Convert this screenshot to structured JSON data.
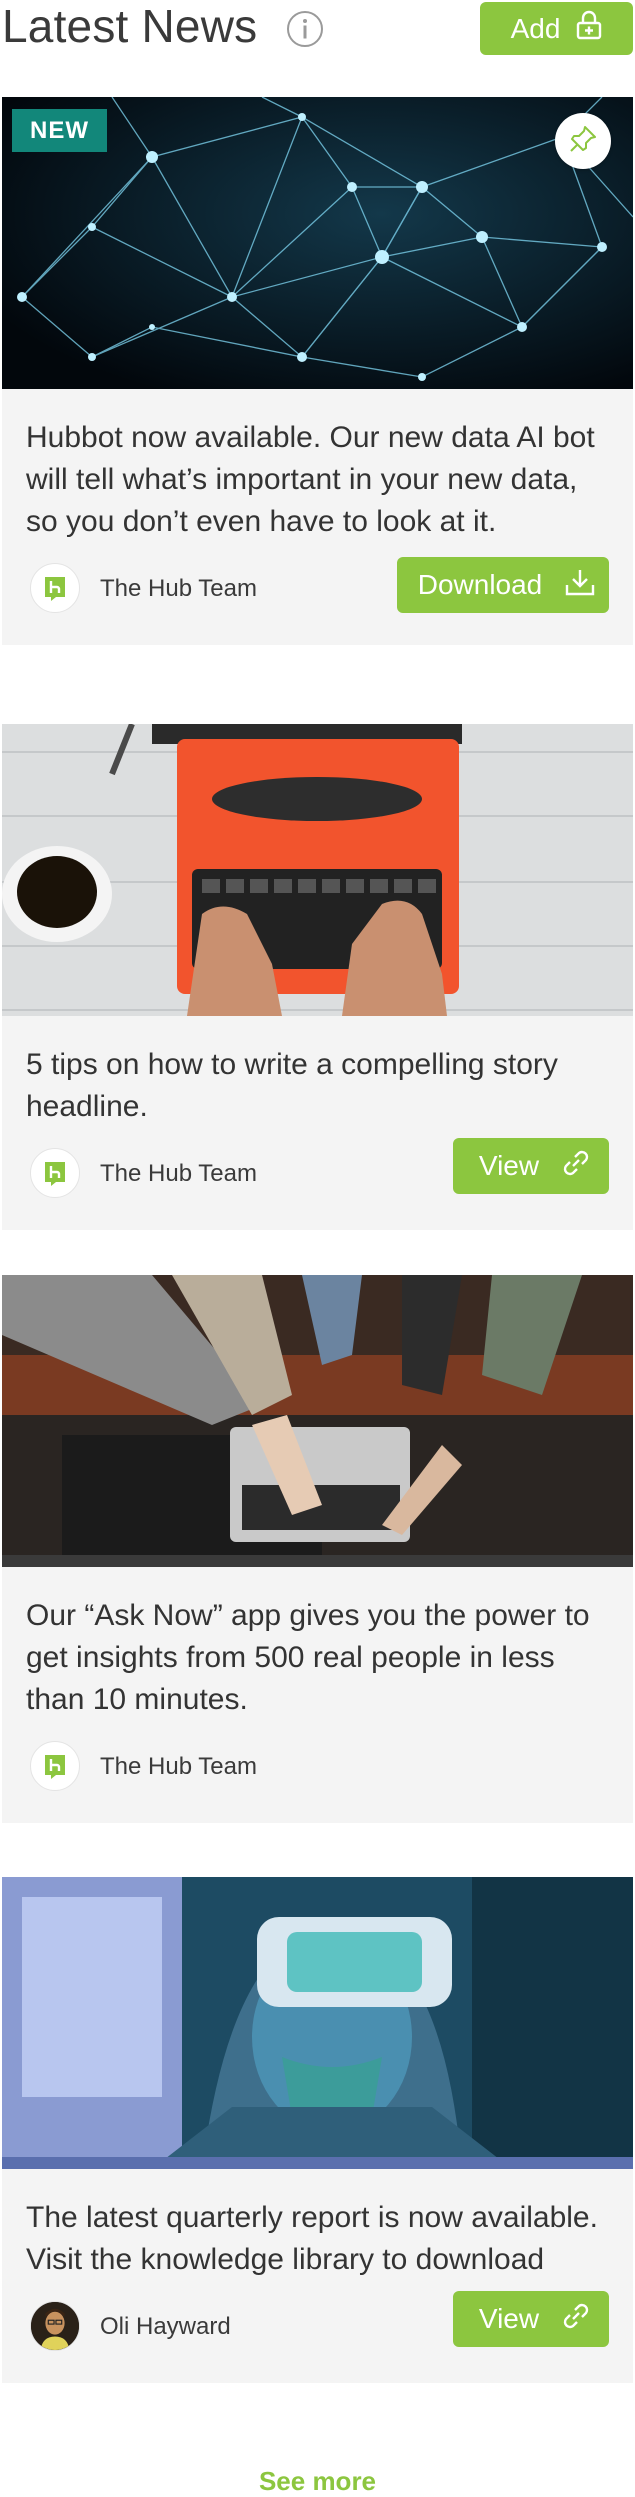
{
  "header": {
    "title": "Latest News",
    "info_icon": "info-icon",
    "add_label": "Add",
    "add_icon": "lock-plus-icon"
  },
  "colors": {
    "accent": "#8cc63f",
    "badge": "#12877a",
    "card_bg": "#f4f4f4"
  },
  "cards": [
    {
      "badge": "NEW",
      "pinned_icon": "pin-icon",
      "image": "network-nodes-image",
      "headline": "Hubbot now available. Our new data AI bot will tell what’s important in your new data, so you don’t even have to look at it.",
      "author": "The Hub Team",
      "author_avatar": "hub-logo-icon",
      "action_label": "Download",
      "action_icon": "download-icon"
    },
    {
      "image": "typewriter-image",
      "headline": "5 tips on how to write a compelling story headline.",
      "author": "The Hub Team",
      "author_avatar": "hub-logo-icon",
      "action_label": "View",
      "action_icon": "link-icon"
    },
    {
      "image": "laptop-hands-image",
      "headline": "Our “Ask Now” app gives you the power to get insights from 500 real people in less than 10 minutes.",
      "author": "The Hub Team",
      "author_avatar": "hub-logo-icon"
    },
    {
      "image": "vr-headset-image",
      "headline": "The latest quarterly report is now available. Visit the knowledge library to download",
      "author": "Oli Hayward",
      "author_avatar": "person-avatar",
      "action_label": "View",
      "action_icon": "link-icon"
    }
  ],
  "see_more_label": "See more"
}
